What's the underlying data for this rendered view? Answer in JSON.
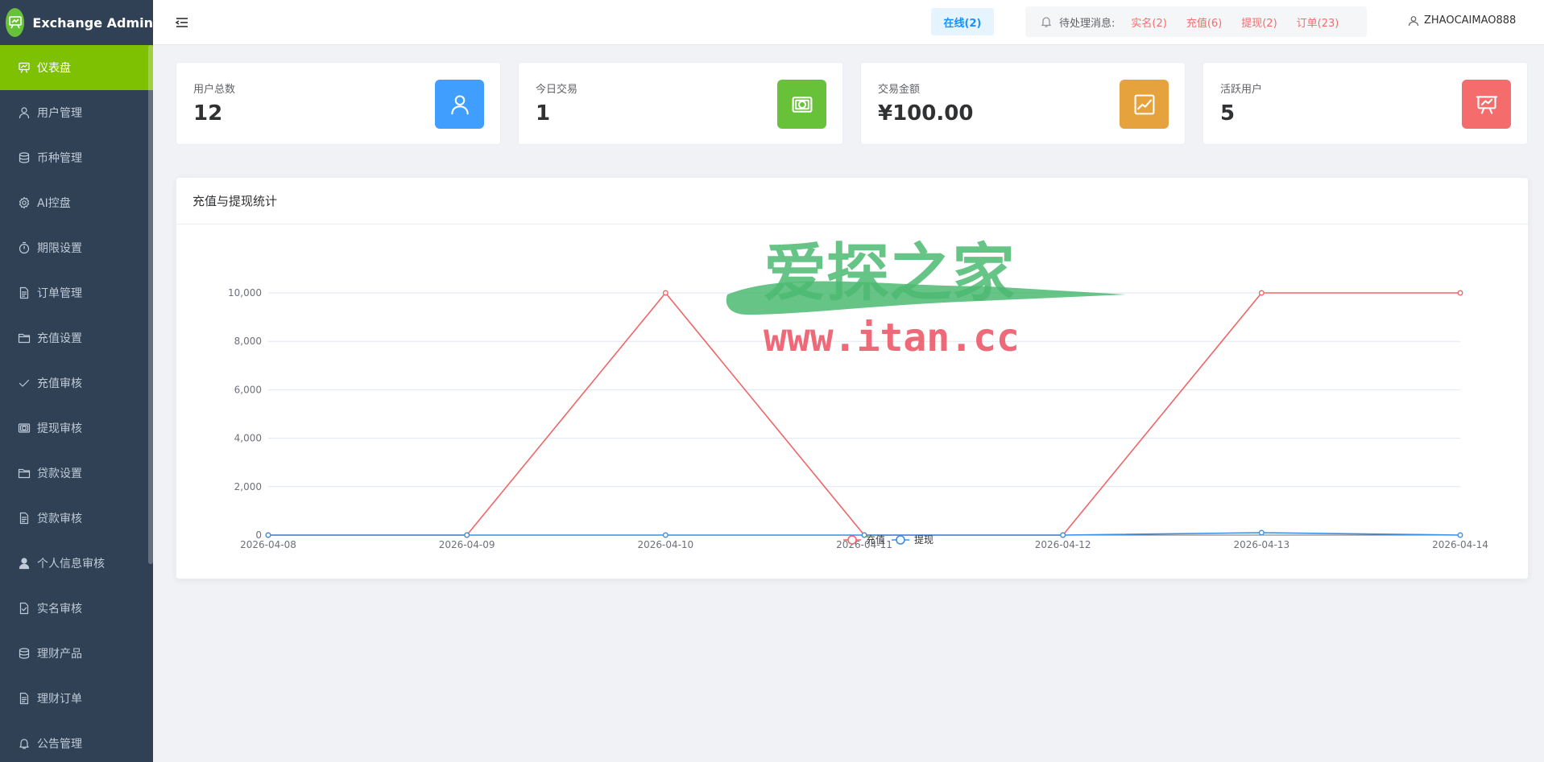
{
  "brand": {
    "title": "Exchange Admin"
  },
  "sidebar": {
    "items": [
      {
        "label": "仪表盘",
        "icon": "dashboard-icon",
        "active": true
      },
      {
        "label": "用户管理",
        "icon": "user-icon"
      },
      {
        "label": "币种管理",
        "icon": "coins-icon"
      },
      {
        "label": "AI控盘",
        "icon": "gear-icon"
      },
      {
        "label": "期限设置",
        "icon": "timer-icon"
      },
      {
        "label": "订单管理",
        "icon": "document-icon"
      },
      {
        "label": "充值设置",
        "icon": "folder-icon"
      },
      {
        "label": "充值审核",
        "icon": "check-icon"
      },
      {
        "label": "提现审核",
        "icon": "money-icon"
      },
      {
        "label": "贷款设置",
        "icon": "folder-icon"
      },
      {
        "label": "贷款审核",
        "icon": "document-icon"
      },
      {
        "label": "个人信息审核",
        "icon": "user-solid-icon"
      },
      {
        "label": "实名审核",
        "icon": "document-check-icon"
      },
      {
        "label": "理财产品",
        "icon": "coins-icon"
      },
      {
        "label": "理财订单",
        "icon": "document-icon"
      },
      {
        "label": "公告管理",
        "icon": "bell-icon"
      }
    ]
  },
  "header": {
    "online": "在线(2)",
    "pending_label": "待处理消息:",
    "pending": [
      "实名(2)",
      "充值(6)",
      "提现(2)",
      "订单(23)"
    ],
    "username": "ZHAOCAIMAO888"
  },
  "cards": [
    {
      "label": "用户总数",
      "value": "12",
      "color": "#409eff",
      "icon": "user-icon"
    },
    {
      "label": "今日交易",
      "value": "1",
      "color": "#67c23a",
      "icon": "money-icon"
    },
    {
      "label": "交易金额",
      "value": "¥100.00",
      "color": "#e6a23c",
      "icon": "trend-chart-icon"
    },
    {
      "label": "活跃用户",
      "value": "5",
      "color": "#f56c6c",
      "icon": "presentation-icon"
    }
  ],
  "chart_panel": {
    "title": "充值与提现统计"
  },
  "chart_data": {
    "type": "line",
    "categories": [
      "2026-04-08",
      "2026-04-09",
      "2026-04-10",
      "2026-04-11",
      "2026-04-12",
      "2026-04-13",
      "2026-04-14"
    ],
    "series": [
      {
        "name": "充值",
        "color": "#ee6666",
        "values": [
          0,
          0,
          10000,
          0,
          0,
          10000,
          10000
        ]
      },
      {
        "name": "提现",
        "color": "#3a8ee6",
        "values": [
          0,
          0,
          0,
          0,
          0,
          100,
          0
        ]
      }
    ],
    "yticks": [
      "0",
      "2,000",
      "4,000",
      "6,000",
      "8,000",
      "10,000"
    ],
    "ylim": [
      0,
      10000
    ],
    "grid": true,
    "legend_position": "bottom-center"
  },
  "watermark": {
    "title": "爱探之家",
    "url": "www.itan.cc"
  }
}
